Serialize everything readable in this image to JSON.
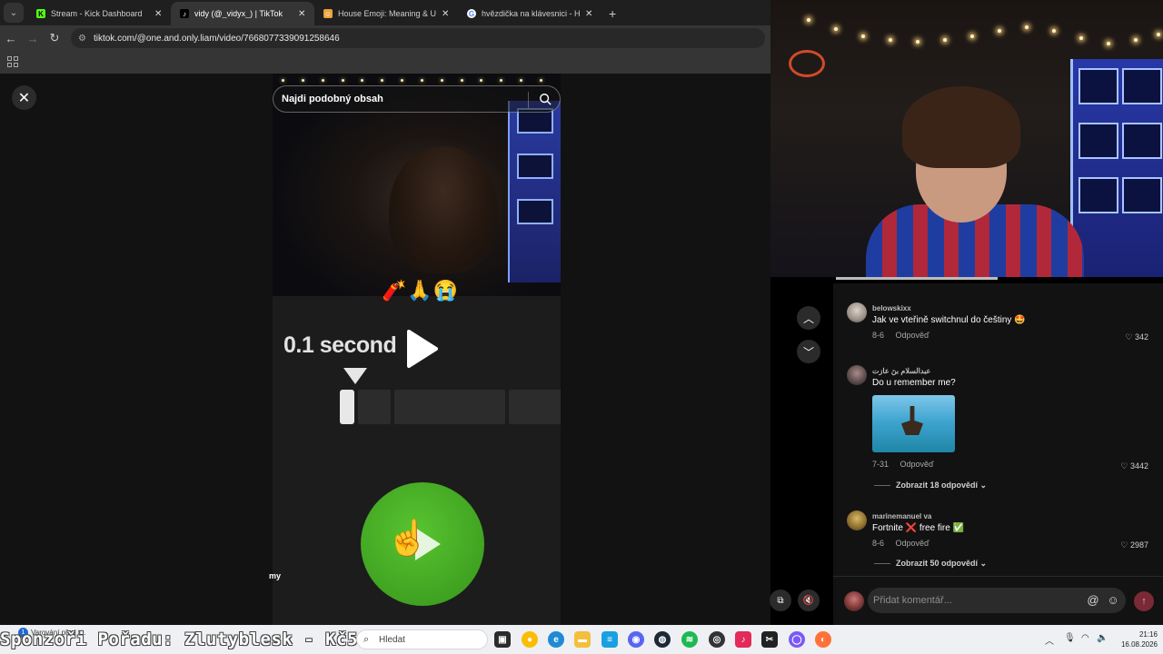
{
  "browser": {
    "tabs": [
      {
        "title": "Stream - Kick Dashboard",
        "favicon": "kick-icon",
        "color": "#53fc18",
        "active": false
      },
      {
        "title": "vidy (@_vidyx_) | TikTok",
        "favicon": "tiktok-icon",
        "color": "#000000",
        "active": true
      },
      {
        "title": "House Emoji: Meaning & Us",
        "favicon": "emojipedia-icon",
        "color": "#e9a23b",
        "active": false
      },
      {
        "title": "hvězdička na klávesnici - Hledat",
        "favicon": "google-icon",
        "color": "#4285f4",
        "active": false
      }
    ],
    "url": "tiktok.com/@one.and.only.liam/video/7668077339091258646"
  },
  "video": {
    "search_placeholder": "Najdi podobný obsah",
    "emojis": "🧨🙏😭",
    "overlay_text": "0.1 second",
    "creator_tag": "my"
  },
  "comments": [
    {
      "user": "belowskixx",
      "text": "Jak ve vteřině switchnul do češtiny 🤩",
      "date": "8-6",
      "reply": "Odpověď",
      "likes": "342"
    },
    {
      "user": "عبدالسلام بنَ عازت",
      "text": "Do u remember me?",
      "date": "7-31",
      "reply": "Odpověď",
      "likes": "3442",
      "replies_label": "Zobrazit 18 odpovědí"
    },
    {
      "user": "marinemanuel va",
      "text": "Fortnite ❌ free fire ✅",
      "date": "8-6",
      "reply": "Odpověď",
      "likes": "2987",
      "replies_label": "Zobrazit 50 odpovědí"
    }
  ],
  "comment_input": {
    "placeholder": "Přidat komentář..."
  },
  "taskbar": {
    "notification": "Varování před t...",
    "notification_count": "1",
    "sponsor_overlay": "Sponzoři Pořadu: Zlutyblesk - Kč50",
    "search_placeholder": "Hledat",
    "time": "21:16",
    "date": "16.08.2026"
  }
}
